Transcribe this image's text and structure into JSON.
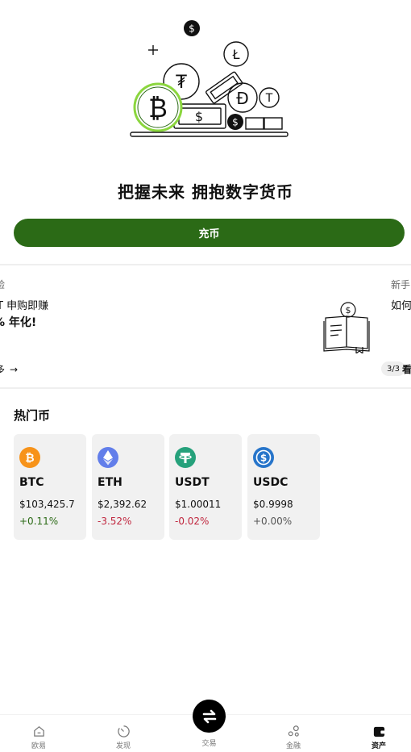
{
  "hero": {
    "title": "把握未来 拥抱数字货币",
    "deposit_label": "充币"
  },
  "banner": {
    "tag": "验",
    "line1": "DT 申购即赚",
    "line2": "% 年化!",
    "more": "多",
    "more_arrow": "→",
    "next_tag": "新手",
    "next_line1": "如何",
    "next_more": "看",
    "page_indicator": "3/3"
  },
  "hot_coins": {
    "title": "热门币",
    "coins": [
      {
        "symbol": "BTC",
        "price": "$103,425.7",
        "change": "+0.11%",
        "icon": "bitcoin-icon",
        "icon_color": "#f7931a",
        "glyph": "₿"
      },
      {
        "symbol": "ETH",
        "price": "$2,392.62",
        "change": "-3.52%",
        "icon": "ethereum-icon",
        "icon_color": "#627eea",
        "glyph": "◆"
      },
      {
        "symbol": "USDT",
        "price": "$1.00011",
        "change": "-0.02%",
        "icon": "tether-icon",
        "icon_color": "#26a17b",
        "glyph": "T"
      },
      {
        "symbol": "USDC",
        "price": "$0.9998",
        "change": "+0.00%",
        "icon": "usdc-icon",
        "icon_color": "#2775ca",
        "glyph": "$"
      }
    ]
  },
  "nav": {
    "items": [
      {
        "label": "欧易",
        "icon": "home-icon"
      },
      {
        "label": "发现",
        "icon": "discover-icon"
      },
      {
        "label": "交易",
        "icon": "trade-swap-icon"
      },
      {
        "label": "金融",
        "icon": "finance-icon"
      },
      {
        "label": "资产",
        "icon": "wallet-icon"
      }
    ],
    "active": "资产"
  },
  "colors": {
    "brand_green": "#2b6a16",
    "up": "#2b6a16",
    "down": "#c0263e",
    "card_bg": "#f1f1f1"
  }
}
